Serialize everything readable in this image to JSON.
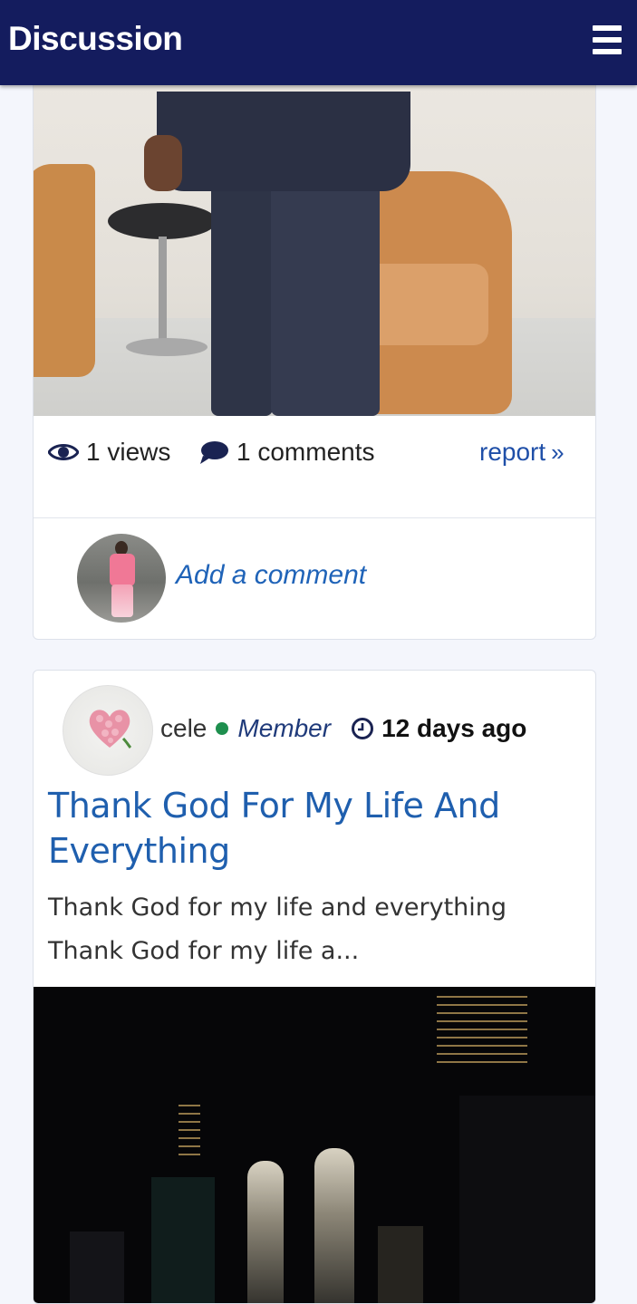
{
  "header": {
    "title": "Discussion",
    "menu_icon": "hamburger-menu-icon",
    "background": "#141c5e"
  },
  "post1": {
    "image_alt": "man in suit standing beside chair",
    "stats": {
      "views_icon": "eye-icon",
      "views_text": "1 views",
      "comments_icon": "comment-bubble-icon",
      "comments_text": "1 comments"
    },
    "report_label": "report",
    "report_icon": "double-chevron-right-icon",
    "comment_prompt": "Add a comment"
  },
  "post2": {
    "author": "cele",
    "online_dot_color": "#1e8f4e",
    "role": "Member",
    "time_icon": "clock-icon",
    "time": "12 days ago",
    "title": "Thank God For My Life And Everything",
    "excerpt": "Thank God for my life and everything Thank God for my life a...",
    "image_alt": "city skyline at night"
  },
  "colors": {
    "accent_link": "#1f4fa8",
    "title_blue": "#1f5fae",
    "page_bg": "#f4f6fc"
  }
}
